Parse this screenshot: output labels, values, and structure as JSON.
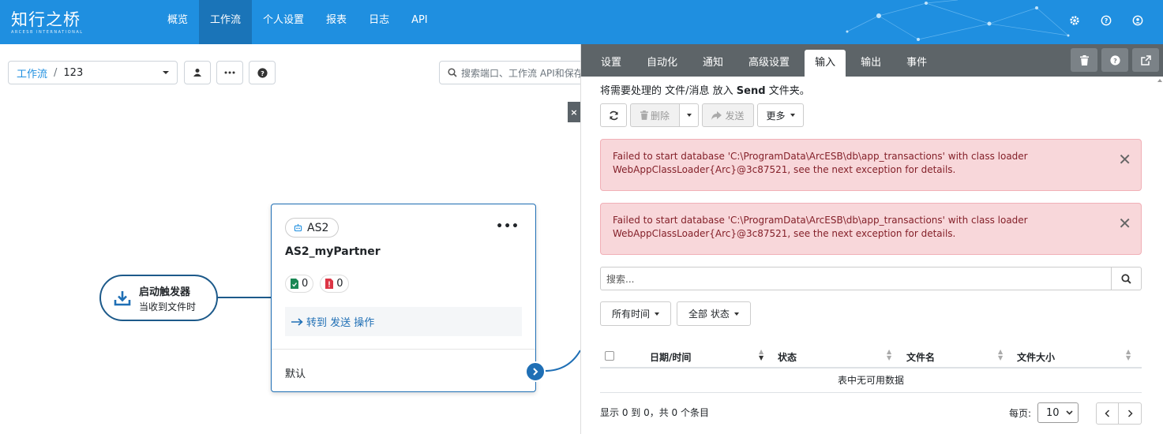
{
  "brand": {
    "name": "知行之桥",
    "sub": "ARCESB INTERNATIONAL"
  },
  "nav": {
    "items": [
      {
        "label": "概览",
        "active": false
      },
      {
        "label": "工作流",
        "active": true
      },
      {
        "label": "个人设置",
        "active": false
      },
      {
        "label": "报表",
        "active": false
      },
      {
        "label": "日志",
        "active": false
      },
      {
        "label": "API",
        "active": false
      }
    ]
  },
  "toolbar": {
    "breadcrumb_root": "工作流",
    "breadcrumb_sep": "/",
    "breadcrumb_current": "123",
    "search_placeholder": "搜索端口、工作流 API和保存"
  },
  "trigger": {
    "title": "启动触发器",
    "subtitle": "当收到文件时"
  },
  "card": {
    "badge": "AS2",
    "name": "AS2_myPartner",
    "success_count": "0",
    "error_count": "0",
    "action_label": "转到 发送 操作",
    "default_label": "默认"
  },
  "panel": {
    "tabs": [
      {
        "label": "设置",
        "active": false
      },
      {
        "label": "自动化",
        "active": false
      },
      {
        "label": "通知",
        "active": false
      },
      {
        "label": "高级设置",
        "active": false
      },
      {
        "label": "输入",
        "active": true
      },
      {
        "label": "输出",
        "active": false
      },
      {
        "label": "事件",
        "active": false
      }
    ],
    "desc_prefix": "将需要处理的 文件/消息 放入",
    "desc_bold": "Send",
    "desc_suffix": "文件夹。",
    "buttons": {
      "delete": "删除",
      "send": "发送",
      "more": "更多"
    },
    "alerts": [
      {
        "line1": "Failed to start database 'C:\\ProgramData\\ArcESB\\db\\app_transactions' with class loader",
        "line2": "WebAppClassLoader{Arc}@3c87521, see the next exception for details."
      },
      {
        "line1": "Failed to start database 'C:\\ProgramData\\ArcESB\\db\\app_transactions' with class loader",
        "line2": "WebAppClassLoader{Arc}@3c87521, see the next exception for details."
      }
    ],
    "search_placeholder": "搜索...",
    "filters": {
      "time": "所有时间",
      "status": "全部 状态"
    },
    "table": {
      "headers": [
        "日期/时间",
        "状态",
        "文件名",
        "文件大小"
      ],
      "empty": "表中无可用数据"
    },
    "footer": {
      "info": "显示 0 到 0，共 0 个条目",
      "per_page_label": "每页:",
      "per_page_value": "10"
    }
  },
  "colors": {
    "topbar": "#1f8fe0",
    "nav_active": "#1a74b8",
    "tabbar": "#5d6468",
    "alert_bg": "#f8d7da",
    "card_border": "#1f6fb5"
  }
}
